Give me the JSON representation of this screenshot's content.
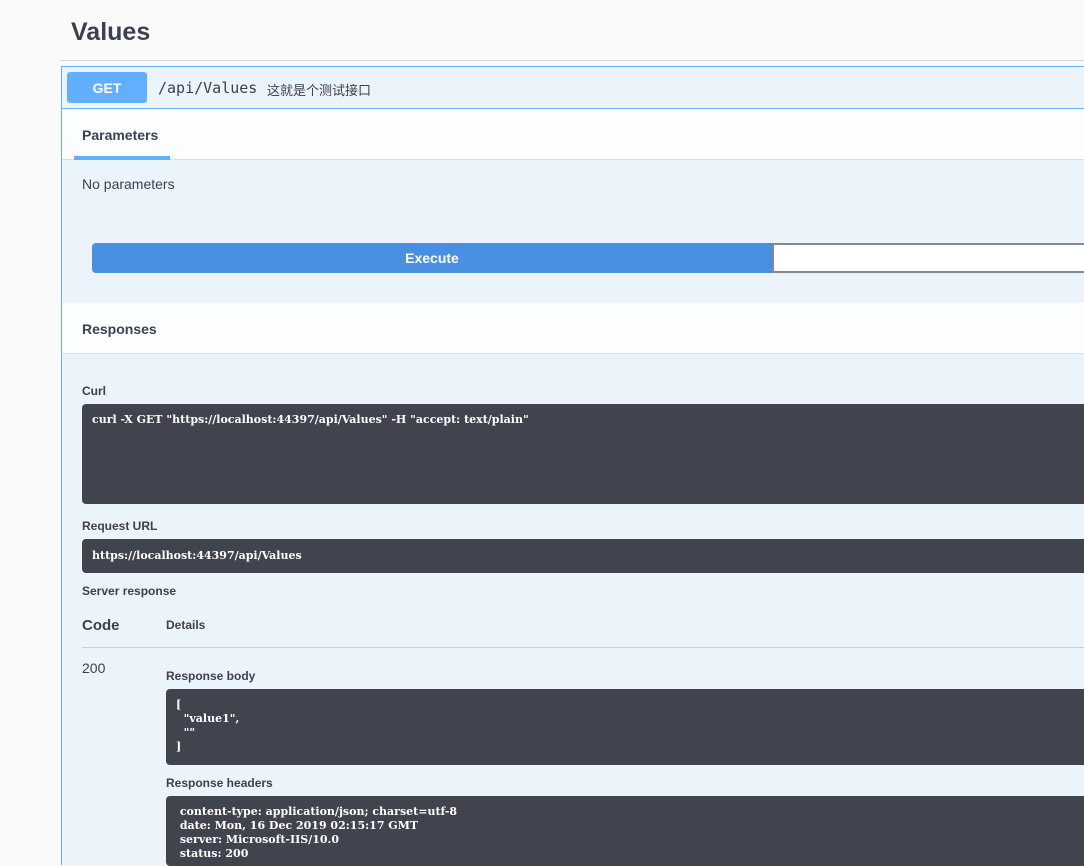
{
  "section": {
    "title": "Values"
  },
  "operation": {
    "method": "GET",
    "path": "/api/Values",
    "description": "这就是个测试接口",
    "color": "#61affe"
  },
  "tabs": {
    "parameters": "Parameters"
  },
  "parameters": {
    "empty_text": "No parameters"
  },
  "actions": {
    "execute_label": "Execute",
    "execute_color": "#4990e2"
  },
  "responses": {
    "title": "Responses",
    "curl_label": "Curl",
    "curl_command": "curl -X GET \"https://localhost:44397/api/Values\" -H \"accept: text/plain\"",
    "request_url_label": "Request URL",
    "request_url": "https://localhost:44397/api/Values",
    "server_response_label": "Server response",
    "table": {
      "code_header": "Code",
      "details_header": "Details",
      "status_code": "200"
    },
    "response_body_label": "Response body",
    "response_body": "[\n  \"value1\",\n  \"\"\n]",
    "response_headers_label": "Response headers",
    "response_headers": " content-type: application/json; charset=utf-8\n date: Mon, 16 Dec 2019 02:15:17 GMT\n server: Microsoft-IIS/10.0\n status: 200"
  }
}
